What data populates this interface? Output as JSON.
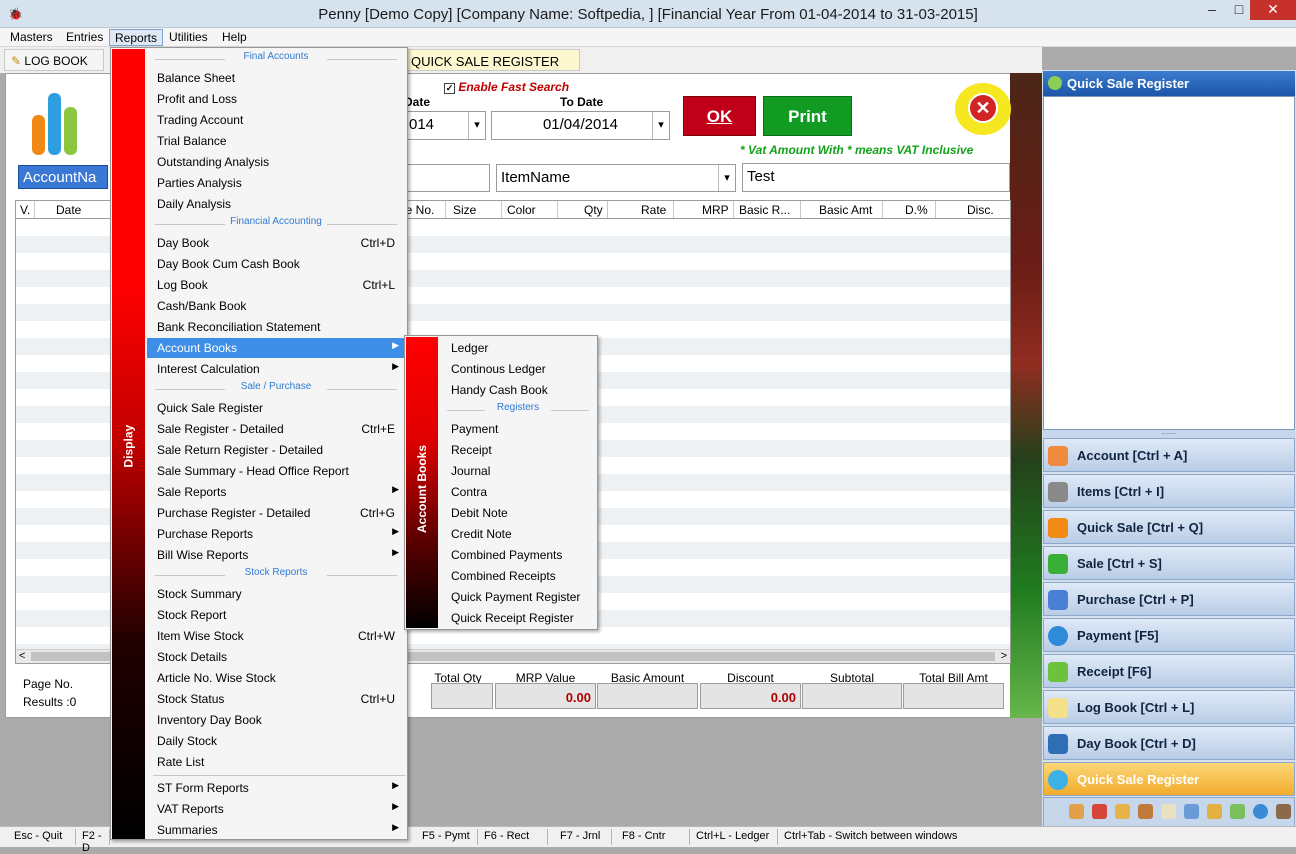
{
  "window": {
    "title": "Penny [Demo Copy] [Company Name: Softpedia, ] [Financial Year From 01-04-2014 to 31-03-2015]",
    "minimize": "–",
    "maximize": "□",
    "close": "✕"
  },
  "menubar": [
    "Masters",
    "Entries",
    "Reports",
    "Utilities",
    "Help"
  ],
  "tabs": {
    "logbook": "LOG BOOK",
    "quicksale": "QUICK SALE REGISTER"
  },
  "filters": {
    "enable_fast_search": "Enable Fast Search",
    "from_date_label": "Date",
    "from_date_value": "014",
    "to_date_label": "To Date",
    "to_date_value": "01/04/2014",
    "ok": "OK",
    "print": "Print",
    "vat_note": "* Vat Amount With * means VAT Inclusive",
    "account_field": "AccountNa",
    "itemname_field": "ItemName",
    "search_value": "Test",
    "dropdown_arrow": "▾"
  },
  "grid": {
    "columns": [
      "V.",
      "Date",
      "de No.",
      "Size",
      "Color",
      "Qty",
      "Rate",
      "MRP",
      "Basic R...",
      "Basic Amt",
      "D.%",
      "Disc."
    ],
    "scroll_left": "<",
    "scroll_right": ">"
  },
  "footer": {
    "page_no": "Page No.",
    "results": "Results :0",
    "total_qty": "Total Qty",
    "mrp_value": "MRP Value",
    "basic_amount": "Basic Amount",
    "discount": "Discount",
    "subtotal": "Subtotal",
    "total_bill_amt": "Total Bill Amt",
    "mrp_value_amt": "0.00",
    "discount_amt": "0.00"
  },
  "right_panel": {
    "title": "Quick Sale Register",
    "buttons": [
      "Account [Ctrl + A]",
      "Items [Ctrl + I]",
      "Quick Sale [Ctrl + Q]",
      "Sale [Ctrl + S]",
      "Purchase [Ctrl + P]",
      "Payment [F5]",
      "Receipt [F6]",
      "Log Book [Ctrl + L]",
      "Day Book [Ctrl + D]",
      "Quick Sale Register"
    ]
  },
  "statusbar": [
    "Esc - Quit",
    "F2 - D",
    "F5 - Pymt",
    "F6 - Rect",
    "F7 - Jrnl",
    "F8 - Cntr",
    "Ctrl+L - Ledger",
    "Ctrl+Tab - Switch between windows"
  ],
  "reports_menu": {
    "band": "Display",
    "sections": {
      "final_accounts": "Final Accounts",
      "financial_accounting": "Financial Accounting",
      "sale_purchase": "Sale / Purchase",
      "stock_reports": "Stock Reports"
    },
    "items": [
      {
        "label": "Balance Sheet",
        "shortcut": ""
      },
      {
        "label": "Profit and Loss",
        "shortcut": ""
      },
      {
        "label": "Trading Account",
        "shortcut": ""
      },
      {
        "label": "Trial Balance",
        "shortcut": ""
      },
      {
        "label": "Outstanding Analysis",
        "shortcut": ""
      },
      {
        "label": "Parties Analysis",
        "shortcut": ""
      },
      {
        "label": "Daily Analysis",
        "shortcut": ""
      },
      {
        "label": "Day Book",
        "shortcut": "Ctrl+D"
      },
      {
        "label": "Day Book Cum Cash Book",
        "shortcut": ""
      },
      {
        "label": "Log Book",
        "shortcut": "Ctrl+L"
      },
      {
        "label": "Cash/Bank Book",
        "shortcut": ""
      },
      {
        "label": "Bank Reconciliation Statement",
        "shortcut": ""
      },
      {
        "label": "Account Books",
        "shortcut": ""
      },
      {
        "label": "Interest Calculation",
        "shortcut": ""
      },
      {
        "label": "Quick Sale Register",
        "shortcut": ""
      },
      {
        "label": "Sale Register - Detailed",
        "shortcut": "Ctrl+E"
      },
      {
        "label": "Sale Return Register - Detailed",
        "shortcut": ""
      },
      {
        "label": "Sale Summary - Head Office Report",
        "shortcut": ""
      },
      {
        "label": "Sale Reports",
        "shortcut": ""
      },
      {
        "label": "Purchase Register - Detailed",
        "shortcut": "Ctrl+G"
      },
      {
        "label": "Purchase Reports",
        "shortcut": ""
      },
      {
        "label": "Bill Wise Reports",
        "shortcut": ""
      },
      {
        "label": "Stock Summary",
        "shortcut": ""
      },
      {
        "label": "Stock Report",
        "shortcut": ""
      },
      {
        "label": "Item Wise Stock",
        "shortcut": "Ctrl+W"
      },
      {
        "label": "Stock Details",
        "shortcut": ""
      },
      {
        "label": "Article No. Wise Stock",
        "shortcut": ""
      },
      {
        "label": "Stock Status",
        "shortcut": "Ctrl+U"
      },
      {
        "label": "Inventory Day Book",
        "shortcut": ""
      },
      {
        "label": "Daily Stock",
        "shortcut": ""
      },
      {
        "label": "Rate List",
        "shortcut": ""
      },
      {
        "label": "ST Form Reports",
        "shortcut": ""
      },
      {
        "label": "VAT Reports",
        "shortcut": ""
      },
      {
        "label": "Summaries",
        "shortcut": ""
      }
    ],
    "submenu_arrow": "▶"
  },
  "account_books_menu": {
    "band": "Account Books",
    "section_registers": "Registers",
    "items": [
      "Ledger",
      "Continous Ledger",
      "Handy Cash Book",
      "Payment",
      "Receipt",
      "Journal",
      "Contra",
      "Debit Note",
      "Credit Note",
      "Combined Payments",
      "Combined Receipts",
      "Quick Payment Register",
      "Quick Receipt Register"
    ]
  },
  "colors": {
    "menu_highlight": "#3d8ee6",
    "band_red": "#ff0000",
    "ok_red": "#c00018",
    "print_green": "#119b22",
    "panel_blue": "#1b56a8"
  }
}
